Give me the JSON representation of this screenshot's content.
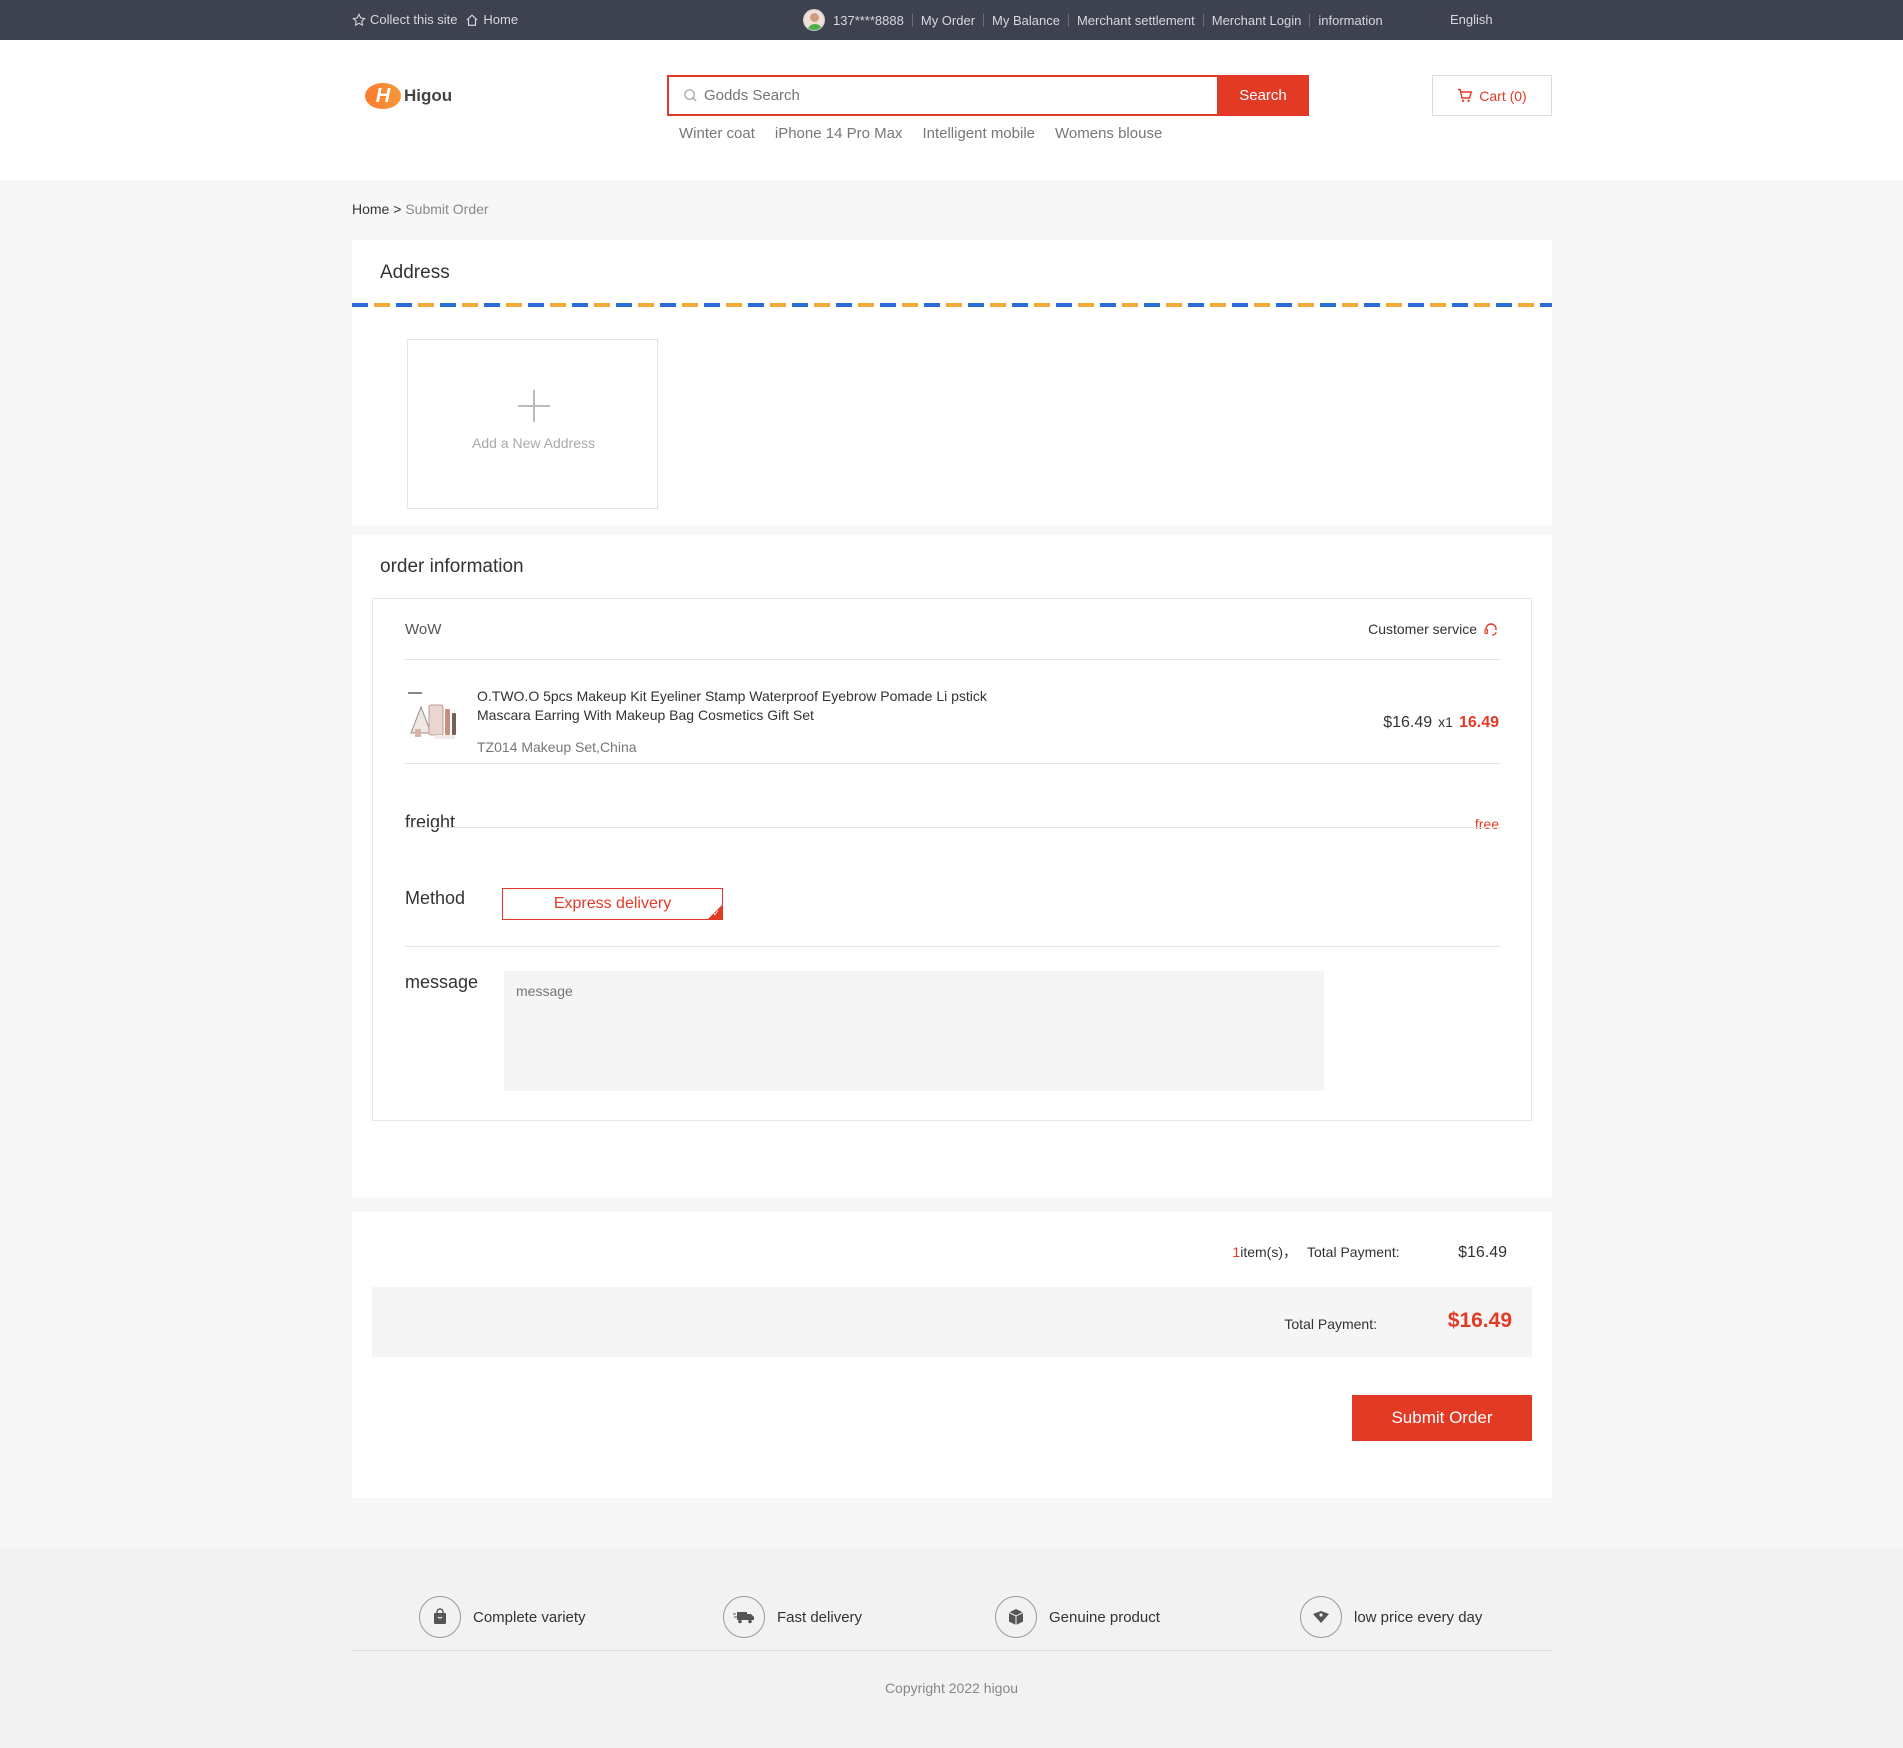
{
  "topbar": {
    "collect": "Collect this site",
    "home": "Home",
    "user": "137****8888",
    "links": [
      "My Order",
      "My Balance",
      "Merchant settlement",
      "Merchant Login",
      "information"
    ],
    "language": "English"
  },
  "header": {
    "logo_mark": "H",
    "logo_text": "Higou",
    "search_placeholder": "Godds Search",
    "search_button": "Search",
    "hot_keywords": [
      "Winter coat",
      "iPhone 14 Pro Max",
      "Intelligent mobile",
      "Womens blouse"
    ],
    "cart": "Cart (0)"
  },
  "breadcrumb": {
    "home": "Home",
    "sep": " > ",
    "current": "Submit Order"
  },
  "address": {
    "title": "Address",
    "add_label": "Add a New Address"
  },
  "order": {
    "title": "order information",
    "shop": "WoW",
    "customer_service": "Customer service",
    "product": {
      "name": "O.TWO.O 5pcs Makeup Kit Eyeliner Stamp Waterproof Eyebrow Pomade Li pstick Mascara Earring With Makeup Bag Cosmetics Gift Set",
      "spec": "TZ014 Makeup Set,China",
      "price": "$16.49",
      "qty": "x1",
      "subtotal": "16.49"
    },
    "freight_label": "freight",
    "freight_value": "free",
    "method_label": "Method",
    "method_value": "Express delivery",
    "message_label": "message",
    "message_placeholder": "message"
  },
  "summary": {
    "count": "1",
    "items_text": " item(s)，",
    "total_label": "Total Payment:",
    "total_value": "$16.49",
    "grand_label": "Total Payment:",
    "grand_value": "$16.49",
    "submit": "Submit Order"
  },
  "footer": {
    "features": [
      "Complete variety",
      "Fast delivery",
      "Genuine product",
      "low price every day"
    ],
    "copyright": "Copyright 2022 higou"
  },
  "colors": {
    "accent": "#e33a26",
    "topbar": "#3e4250",
    "stripe_blue": "#2d6bd6",
    "stripe_orange": "#f3a93c"
  }
}
